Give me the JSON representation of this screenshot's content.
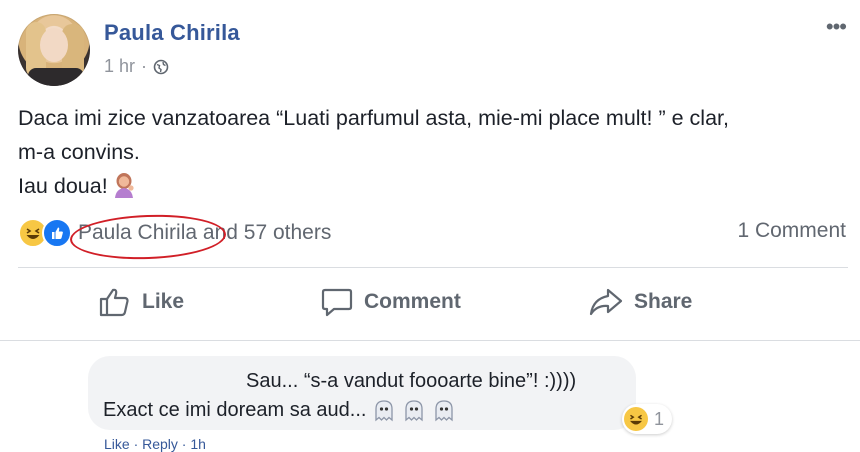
{
  "post": {
    "author": "Paula Chirila",
    "time": "1 hr",
    "separator": "·",
    "privacy_icon": "globe-icon",
    "more_icon": "ellipsis-icon",
    "more_glyph": "•••",
    "text_lines": [
      "Daca imi zice vanzatoarea “Luati parfumul asta, mie-mi place mult! ” e clar,",
      "m-a convins.",
      "Iau doua!"
    ],
    "text_emoji": "person-tipping-hand-emoji"
  },
  "reactions": {
    "icons": [
      "haha-reaction-icon",
      "like-reaction-icon"
    ],
    "names_highlight": "Paula Chirila",
    "names_rest": " and 57 others",
    "comments_count": "1 Comment"
  },
  "actions": {
    "like": "Like",
    "comment": "Comment",
    "share": "Share"
  },
  "comment": {
    "line1": "Sau... “s-a vandut foooarte bine”! :))))",
    "line2": "Exact ce imi doream sa aud...",
    "emojis": [
      "ghost-emoji",
      "ghost-emoji",
      "ghost-emoji"
    ],
    "reaction_icon": "haha-reaction-icon",
    "reaction_count": "1",
    "footer_partial": "Like · Reply · 1h"
  },
  "colors": {
    "name_blue": "#365899",
    "meta_grey": "#90949c",
    "text": "#1d2129",
    "annotation_red": "#d11f27",
    "like_blue": "#1877f2",
    "haha_yellow": "#f7c744"
  }
}
